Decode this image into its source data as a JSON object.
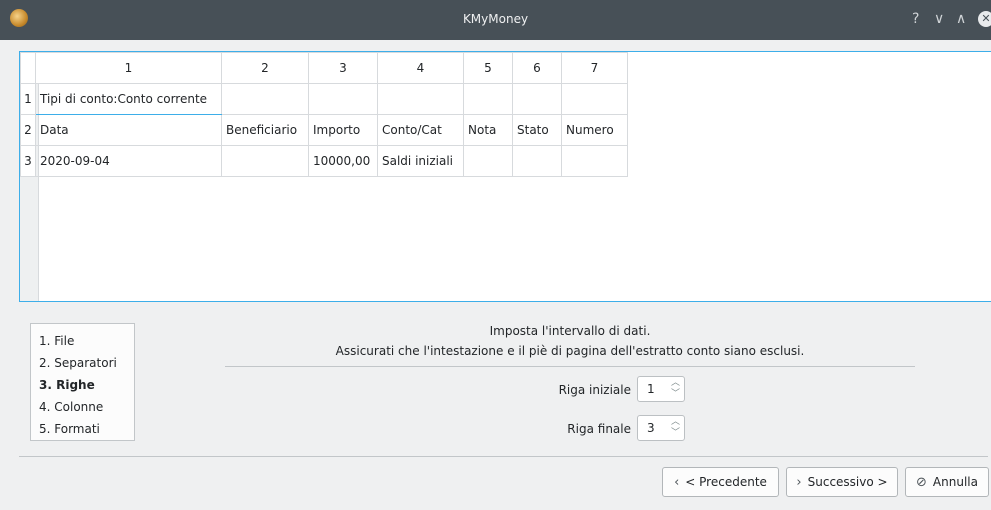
{
  "window": {
    "title": "KMyMoney",
    "help": "?",
    "minimize": "∨",
    "maximize": "∧",
    "close": "✕"
  },
  "table": {
    "column_headers": [
      "1",
      "2",
      "3",
      "4",
      "5",
      "6",
      "7"
    ],
    "row_headers": [
      "1",
      "2",
      "3"
    ],
    "rows": [
      [
        "Tipi di conto:Conto corrente",
        "",
        "",
        "",
        "",
        "",
        ""
      ],
      [
        "Data",
        "Beneficiario",
        "Importo",
        "Conto/Cat",
        "Nota",
        "Stato",
        "Numero"
      ],
      [
        "2020-09-04",
        "",
        "10000,00",
        "Saldi iniziali",
        "",
        "",
        ""
      ]
    ]
  },
  "steps": [
    {
      "label": "1. File",
      "active": false
    },
    {
      "label": "2. Separatori",
      "active": false
    },
    {
      "label": "3. Righe",
      "active": true
    },
    {
      "label": "4. Colonne",
      "active": false
    },
    {
      "label": "5. Formati",
      "active": false
    }
  ],
  "instructions": {
    "line1": "Imposta l'intervallo di dati.",
    "line2": "Assicurati che l'intestazione e il piè di pagina dell'estratto conto siano esclusi."
  },
  "start_row": {
    "label": "Riga iniziale",
    "value": "1"
  },
  "end_row": {
    "label": "Riga finale",
    "value": "3"
  },
  "buttons": {
    "prev": "< Precedente",
    "next": "Successivo >",
    "cancel": "Annulla"
  }
}
